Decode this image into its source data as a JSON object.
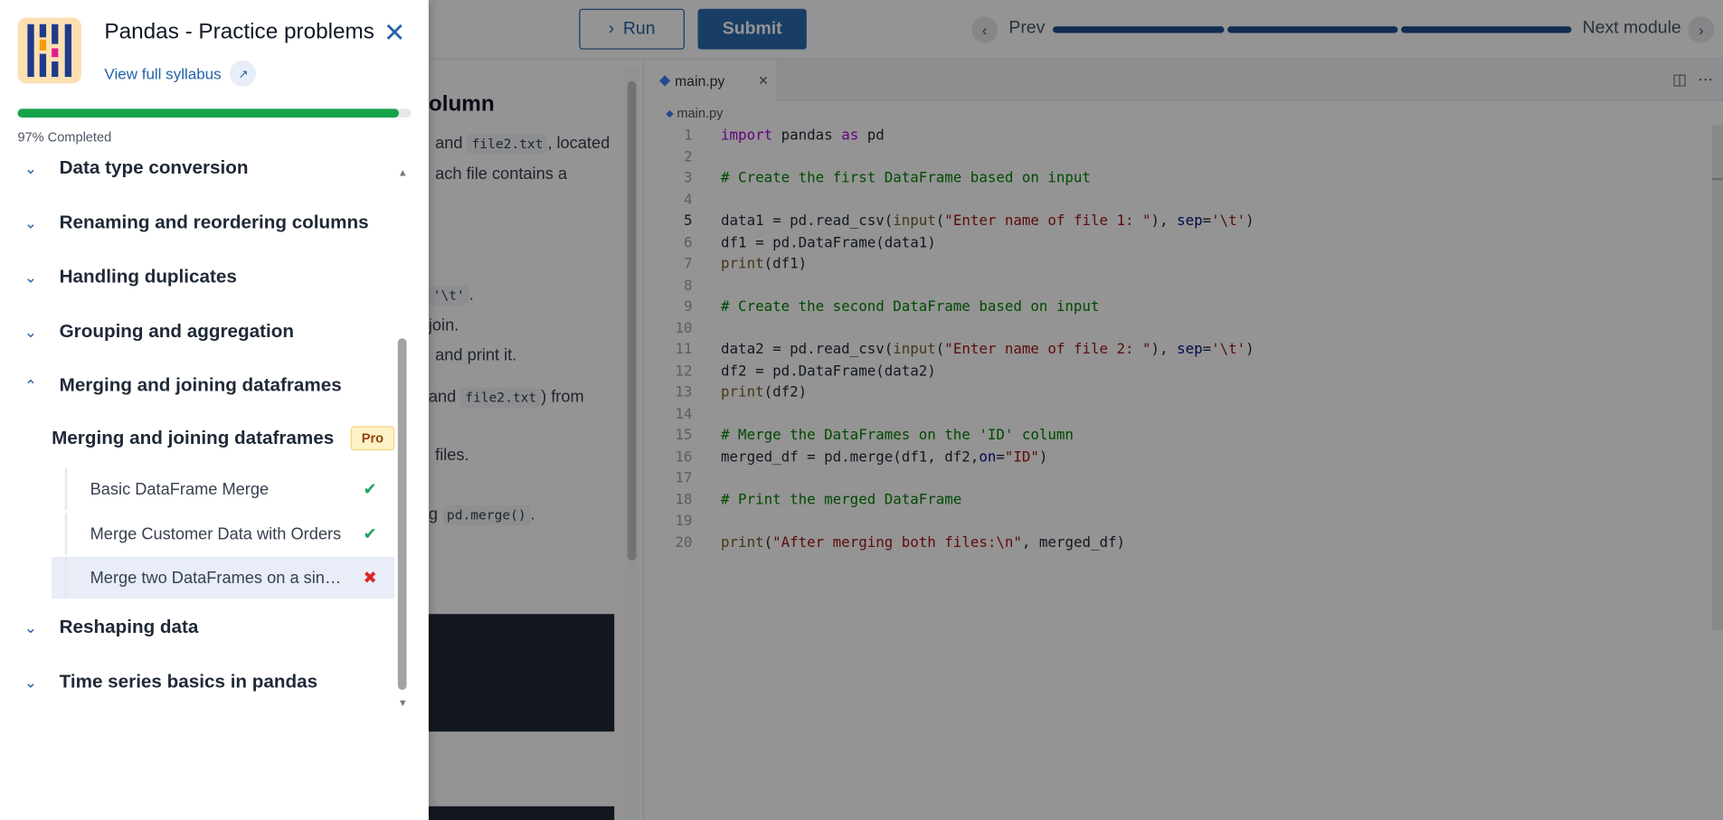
{
  "toolbar": {
    "run_label": "Run",
    "submit_label": "Submit",
    "prev_label": "Prev",
    "next_label": "Next module"
  },
  "left_pane": {
    "title_fragment": "olumn",
    "lines": [
      {
        "pre": "",
        "code": "",
        "mid": " and ",
        "code2": "file2.txt",
        "post": ", located"
      },
      {
        "pre": "ach file contains a",
        "code": "",
        "mid": "",
        "code2": "",
        "post": ""
      },
      {
        "pre": "",
        "code": "'\\t'",
        "mid": "",
        "code2": "",
        "post": "."
      },
      {
        "pre": "join.",
        "code": "",
        "mid": "",
        "code2": "",
        "post": ""
      },
      {
        "pre": "",
        "code": "",
        "mid": " and print it.",
        "code2": "",
        "post": ""
      },
      {
        "pre": "",
        "code": "",
        "mid": " and ",
        "code2": "file2.txt",
        "post": ") from"
      },
      {
        "pre": "files.",
        "code": "",
        "mid": "",
        "code2": "",
        "post": ""
      },
      {
        "pre": "g ",
        "code": "pd.merge()",
        "mid": "",
        "code2": "",
        "post": "."
      }
    ]
  },
  "editor": {
    "tab_label": "main.py",
    "breadcrumb": "main.py",
    "code_lines": [
      "import pandas as pd",
      "",
      "# Create the first DataFrame based on input",
      "",
      "data1 = pd.read_csv(input(\"Enter name of file 1: \"), sep='\\t')",
      "df1 = pd.DataFrame(data1)",
      "print(df1)",
      "",
      "# Create the second DataFrame based on input",
      "",
      "data2 = pd.read_csv(input(\"Enter name of file 2: \"), sep='\\t')",
      "df2 = pd.DataFrame(data2)",
      "print(df2)",
      "",
      "# Merge the DataFrames on the 'ID' column",
      "merged_df = pd.merge(df1, df2,on=\"ID\")",
      "",
      "# Print the merged DataFrame",
      "",
      "print(\"After merging both files:\\n\", merged_df)"
    ]
  },
  "drawer": {
    "course_title": "Pandas - Practice problems",
    "syllabus_link": "View full syllabus",
    "progress_percent": 97,
    "progress_label": "97% Completed",
    "sections_top": [
      {
        "label": "Data type conversion",
        "expanded": false
      },
      {
        "label": "Renaming and reordering columns",
        "expanded": false
      },
      {
        "label": "Handling duplicates",
        "expanded": false
      },
      {
        "label": "Grouping and aggregation",
        "expanded": false
      },
      {
        "label": "Merging and joining dataframes",
        "expanded": true
      }
    ],
    "subsection": {
      "label": "Merging and joining dataframes",
      "badge": "Pro"
    },
    "lessons": [
      {
        "label": "Basic DataFrame Merge",
        "status": "passed"
      },
      {
        "label": "Merge Customer Data with Orders",
        "status": "passed"
      },
      {
        "label": "Merge two DataFrames on a single column",
        "status": "failed",
        "selected": true
      }
    ],
    "sections_bottom": [
      {
        "label": "Reshaping data",
        "expanded": false
      },
      {
        "label": "Time series basics in pandas",
        "expanded": false
      }
    ]
  },
  "colors": {
    "accent": "#2563a8",
    "progress": "#16a34a",
    "pass": "#22a45d",
    "fail": "#dc2626",
    "pro_bg": "#fef3c7"
  }
}
